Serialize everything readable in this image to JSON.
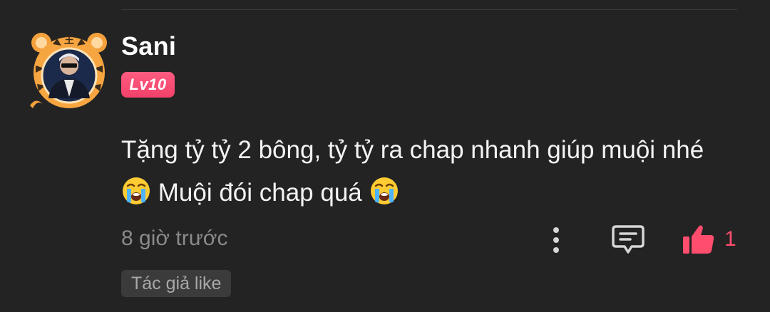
{
  "user": {
    "name": "Sani",
    "level": "Lv10",
    "avatar_frame": "tiger-frame",
    "avatar_frame_glyph": "王"
  },
  "comment": {
    "text_part1": "Tặng tỷ tỷ 2 bông, tỷ tỷ ra chap nhanh giúp muội nhé",
    "text_part2": "Muội đói chap quá",
    "emoji": "crying-face"
  },
  "meta": {
    "time": "8 giờ trước",
    "like_count": "1",
    "author_tag": "Tác giả like"
  },
  "icons": {
    "more": "more-vertical-icon",
    "reply": "comment-reply-icon",
    "like": "thumbs-up-icon"
  },
  "colors": {
    "background": "#232323",
    "accent": "#ff4d6d",
    "badge": "#f2416a",
    "muted_text": "#8a8a8a",
    "tag_background": "#3b3b3b"
  }
}
